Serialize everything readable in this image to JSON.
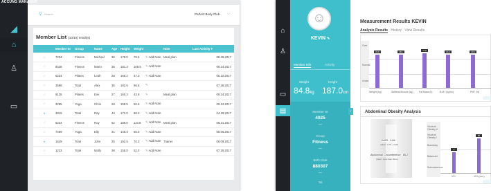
{
  "left_app": {
    "brand": "ACCUNG MANAGER",
    "search_placeholder": "Search",
    "club_selector": "Perfect Body Club",
    "title": "Member List",
    "result_count": "(10/10) result(s)",
    "columns": [
      "",
      "Member ID",
      "Group",
      "Name",
      "Age",
      "Height",
      "Weight",
      "",
      "Note",
      "Last Activity ▾"
    ],
    "rows": [
      {
        "id": "7234",
        "group": "Fitness",
        "name": "Michael",
        "age": "36",
        "height": "178.0",
        "weight": "78.5",
        "add": "Add Note",
        "note": "Meal plan",
        "last": "08.29.2017",
        "flag": false
      },
      {
        "id": "8438",
        "group": "Fitness",
        "name": "Mario",
        "age": "35",
        "height": "181.3",
        "weight": "108.5",
        "add": "Add Note",
        "note": "",
        "last": "09.24.2017",
        "flag": false
      },
      {
        "id": "6234",
        "group": "Pilates",
        "name": "Leah",
        "age": "28",
        "height": "165.2",
        "weight": "47.3",
        "add": "Add Note",
        "note": "",
        "last": "05.22.2017",
        "flag": false
      },
      {
        "id": "3598",
        "group": "Total",
        "name": "Alex",
        "age": "35",
        "height": "182.6",
        "weight": "95.6",
        "add": "",
        "note": "",
        "last": "07.28.2017",
        "flag": false
      },
      {
        "id": "9135",
        "group": "Pilates",
        "name": "Eve",
        "age": "27",
        "height": "160.2",
        "weight": "43.6",
        "add": "",
        "note": "Meal plan",
        "last": "09.24.2017",
        "flag": false
      },
      {
        "id": "4285",
        "group": "Yoga",
        "name": "Chris",
        "age": "28",
        "height": "158.5",
        "weight": "55.5",
        "add": "Add Note",
        "note": "",
        "last": "09.24.2017",
        "flag": false
      },
      {
        "id": "3819",
        "group": "Total",
        "name": "Ray",
        "age": "44",
        "height": "172.0",
        "weight": "98.2",
        "add": "Add Note",
        "note": "",
        "last": "04.29.2017",
        "flag": true
      },
      {
        "id": "6234",
        "group": "Fitness",
        "name": "Roy",
        "age": "52",
        "height": "189.0",
        "weight": "110.8",
        "add": "Add Note",
        "note": "Meal plan",
        "last": "08.31.2017",
        "flag": false
      },
      {
        "id": "7469",
        "group": "Yoga",
        "name": "Elly",
        "age": "21",
        "height": "148.3",
        "weight": "65.0",
        "add": "Add Note",
        "note": "",
        "last": "08.05.2017",
        "flag": false
      },
      {
        "id": "1649",
        "group": "Total",
        "name": "John",
        "age": "25",
        "height": "192.5",
        "weight": "70.3",
        "add": "Add Note",
        "note": "Trainer",
        "last": "08.09.2017",
        "flag": true
      },
      {
        "id": "1223",
        "group": "Total",
        "name": "Molly",
        "age": "38",
        "height": "155.0",
        "weight": "52.0",
        "add": "Add Note",
        "note": "",
        "last": "07.29.2017",
        "flag": false
      }
    ]
  },
  "right_app": {
    "profile_name": "KEVIN",
    "tabs": [
      "Member Info",
      "Activity"
    ],
    "weight_label": "Weight",
    "weight_value": "84.8",
    "weight_unit": "kg",
    "height_label": "Height",
    "height_value": "187.0",
    "height_unit": "cm",
    "member_id_label": "Member ID",
    "member_id": "4925",
    "group_label": "Group",
    "group": "Fitness",
    "birth_label": "Birth Date",
    "birth": "880307",
    "tel_label": "Tel",
    "measure_title": "Measurement Results",
    "measure_name": "KEVIN",
    "measure_tabs": [
      "Analysis Results",
      "History",
      "View Results"
    ],
    "chart_levels": [
      "Over",
      "Normal",
      "Under"
    ],
    "chart_cols": [
      "Weight (kg)",
      "Skeletal Muscle (kg)",
      "Fat Mass (k)",
      "B.M.I (kg/m²)",
      "PBF (%)"
    ],
    "chart_vals": [
      "84.8",
      "38.1",
      "17.8",
      "24.2",
      "20.9"
    ],
    "obesity_title": "Abdominal Obesity Analysis",
    "whr": "WHR : 0.84",
    "whr_ideal": "(Ideal : 0.75 ~ 0.90)",
    "abd_circ": "Abdominal Circumference : 85.2",
    "abd_ideal": "(Ideal : Less than 90cm)",
    "obesity_levels": [
      "Visceral Obesity II",
      "Visceral Obesity I",
      "Boundary",
      "Balanced",
      "Subcutaneous"
    ],
    "obesity_cols": [
      "VFL",
      "VFA (cm²)"
    ],
    "obesity_vals": [
      "9",
      "85"
    ]
  },
  "colors": {
    "sidebar": "#1f2227",
    "teal": "#3fbfcb",
    "purple": "#8d6ad6"
  }
}
